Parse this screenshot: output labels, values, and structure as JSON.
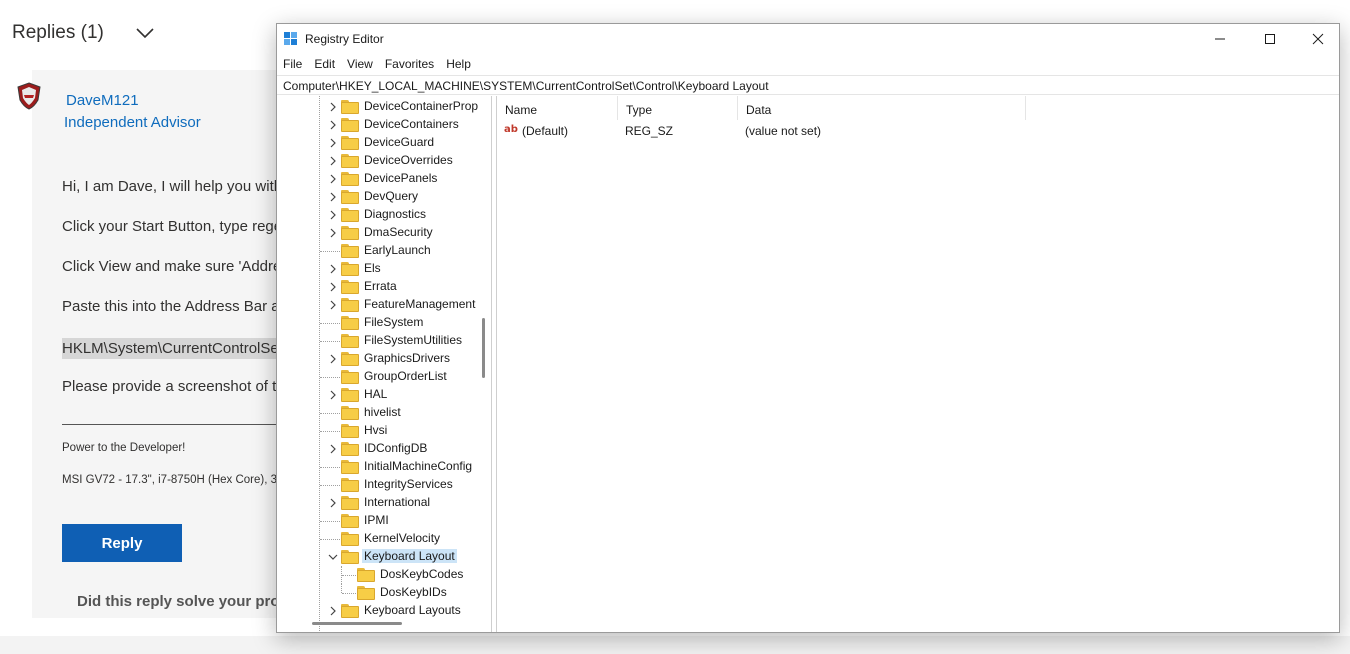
{
  "forum": {
    "replies_title": "Replies (1)",
    "author_name": "DaveM121",
    "author_role": "Independent Advisor",
    "lines": [
      "Hi, I am Dave, I will help you with",
      "Click your Start Button, type rege",
      "Click View and make sure 'Addre",
      "Paste this into the Address Bar a",
      "HKLM\\System\\CurrentControlSe",
      "Please provide a screenshot of th"
    ],
    "signature_1": "Power to the Developer!",
    "signature_2": "MSI GV72 - 17.3\", i7-8750H (Hex Core), 3",
    "reply_button": "Reply",
    "solved_question": "Did this reply solve your prob"
  },
  "regedit": {
    "title": "Registry Editor",
    "menu": [
      "File",
      "Edit",
      "View",
      "Favorites",
      "Help"
    ],
    "address": "Computer\\HKEY_LOCAL_MACHINE\\SYSTEM\\CurrentControlSet\\Control\\Keyboard Layout",
    "tree": [
      {
        "label": "DeviceContainerProp",
        "expandable": true,
        "level": 0
      },
      {
        "label": "DeviceContainers",
        "expandable": true,
        "level": 0
      },
      {
        "label": "DeviceGuard",
        "expandable": true,
        "level": 0
      },
      {
        "label": "DeviceOverrides",
        "expandable": true,
        "level": 0
      },
      {
        "label": "DevicePanels",
        "expandable": true,
        "level": 0
      },
      {
        "label": "DevQuery",
        "expandable": true,
        "level": 0
      },
      {
        "label": "Diagnostics",
        "expandable": true,
        "level": 0
      },
      {
        "label": "DmaSecurity",
        "expandable": true,
        "level": 0
      },
      {
        "label": "EarlyLaunch",
        "expandable": false,
        "level": 0
      },
      {
        "label": "Els",
        "expandable": true,
        "level": 0
      },
      {
        "label": "Errata",
        "expandable": true,
        "level": 0
      },
      {
        "label": "FeatureManagement",
        "expandable": true,
        "level": 0
      },
      {
        "label": "FileSystem",
        "expandable": false,
        "level": 0
      },
      {
        "label": "FileSystemUtilities",
        "expandable": false,
        "level": 0
      },
      {
        "label": "GraphicsDrivers",
        "expandable": true,
        "level": 0
      },
      {
        "label": "GroupOrderList",
        "expandable": false,
        "level": 0
      },
      {
        "label": "HAL",
        "expandable": true,
        "level": 0
      },
      {
        "label": "hivelist",
        "expandable": false,
        "level": 0
      },
      {
        "label": "Hvsi",
        "expandable": false,
        "level": 0
      },
      {
        "label": "IDConfigDB",
        "expandable": true,
        "level": 0
      },
      {
        "label": "InitialMachineConfig",
        "expandable": false,
        "level": 0
      },
      {
        "label": "IntegrityServices",
        "expandable": false,
        "level": 0
      },
      {
        "label": "International",
        "expandable": true,
        "level": 0
      },
      {
        "label": "IPMI",
        "expandable": false,
        "level": 0
      },
      {
        "label": "KernelVelocity",
        "expandable": false,
        "level": 0
      },
      {
        "label": "Keyboard Layout",
        "expandable": true,
        "expanded": true,
        "selected": true,
        "level": 0
      },
      {
        "label": "DosKeybCodes",
        "expandable": false,
        "level": 1
      },
      {
        "label": "DosKeybIDs",
        "expandable": false,
        "level": 1
      },
      {
        "label": "Keyboard Layouts",
        "expandable": true,
        "level": 0
      }
    ],
    "columns": [
      "Name",
      "Type",
      "Data"
    ],
    "values": [
      {
        "name": "(Default)",
        "type": "REG_SZ",
        "data": "(value not set)",
        "icon": "string-value-icon"
      }
    ]
  },
  "colors": {
    "accent": "#0f6cbd",
    "reply_button": "#0f5fb4",
    "selection": "#cce4f7",
    "folder": "#f7cd46"
  }
}
